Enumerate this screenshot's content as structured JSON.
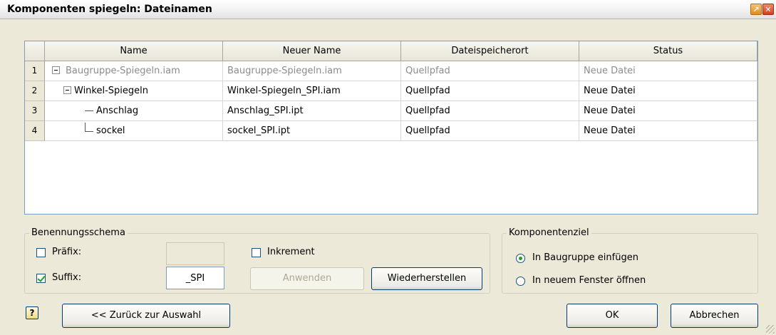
{
  "window": {
    "title": "Komponenten spiegeln: Dateinamen"
  },
  "grid": {
    "columns": [
      "Name",
      "Neuer Name",
      "Dateispeicherort",
      "Status"
    ],
    "rows": [
      {
        "num": "1",
        "name": "Baugruppe-Spiegeln.iam",
        "new_name": "Baugruppe-Spiegeln.iam",
        "location": "Quellpfad",
        "status": "Neue Datei"
      },
      {
        "num": "2",
        "name": "Winkel-Spiegeln",
        "new_name": "Winkel-Spiegeln_SPI.iam",
        "location": "Quellpfad",
        "status": "Neue Datei"
      },
      {
        "num": "3",
        "name": "Anschlag",
        "new_name": "Anschlag_SPI.ipt",
        "location": "Quellpfad",
        "status": "Neue Datei"
      },
      {
        "num": "4",
        "name": "sockel",
        "new_name": "sockel_SPI.ipt",
        "location": "Quellpfad",
        "status": "Neue Datei"
      }
    ]
  },
  "naming": {
    "legend": "Benennungsschema",
    "prefix_label": "Präfix:",
    "prefix_value": "",
    "suffix_label": "Suffix:",
    "suffix_value": "_SPI",
    "increment_label": "Inkrement",
    "apply_label": "Anwenden",
    "restore_label": "Wiederherstellen"
  },
  "target": {
    "legend": "Komponentenziel",
    "option_insert": "In Baugruppe einfügen",
    "option_new_window": "In neuem Fenster öffnen"
  },
  "footer": {
    "help_glyph": "?",
    "back_label": "<< Zurück zur Auswahl",
    "ok_label": "OK",
    "cancel_label": "Abbrechen"
  },
  "colors": {
    "dialog_bg": "#ece9d8",
    "grid_border": "#7f9db9",
    "check_green": "#21a121"
  },
  "icons": [
    "pin-icon",
    "close-icon",
    "help-icon",
    "collapse-icon",
    "resize-grip-icon"
  ]
}
